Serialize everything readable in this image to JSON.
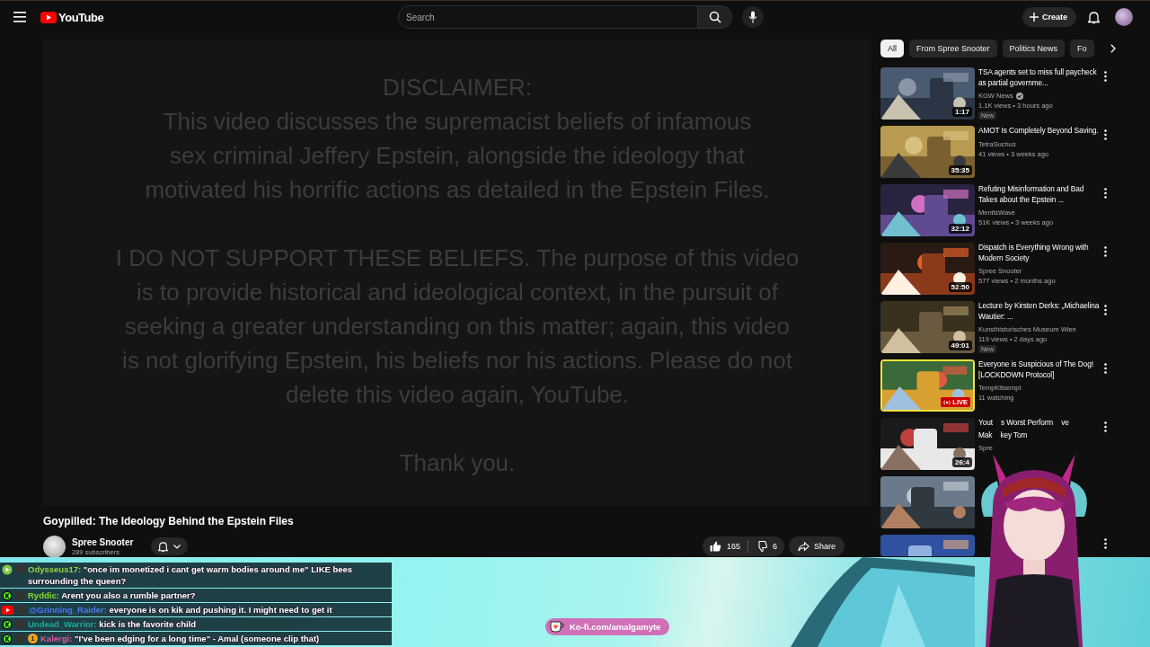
{
  "header": {
    "logo_text": "YouTube",
    "search": {
      "placeholder": "Search"
    },
    "create_label": "Create"
  },
  "video": {
    "disclaimer": [
      [
        "DISCLAIMER:",
        "This video discusses the supremacist beliefs of infamous",
        "sex criminal Jeffery Epstein, alongside the ideology that",
        "motivated his horrific actions as detailed in the Epstein Files."
      ],
      [
        "I DO NOT SUPPORT THESE BELIEFS. The purpose of this video",
        "is to provide historical and ideological context, in the pursuit of",
        "seeking a greater understanding on this matter; again, this video",
        "is not glorifying Epstein, his beliefs nor his actions. Please do not",
        "delete this video again, YouTube."
      ],
      [
        "Thank you."
      ]
    ],
    "title": "Goypilled: The Ideology Behind the Epstein Files",
    "channel": {
      "name": "Spree Snooter",
      "subscribers": "289 subscribers"
    },
    "likes": "165",
    "dislikes": "6",
    "share_label": "Share"
  },
  "chips": [
    {
      "label": "All",
      "selected": true
    },
    {
      "label": "From Spree Snooter",
      "selected": false
    },
    {
      "label": "Politics News",
      "selected": false
    },
    {
      "label": "Fo",
      "selected": false
    }
  ],
  "recommendations": [
    {
      "kind": "video",
      "title": "TSA agents set to miss full paycheck as partial governme...",
      "channel": "KGW News",
      "verified": true,
      "meta": "1.1K views • 3 hours ago",
      "badge": "New",
      "duration": "1:17",
      "menu": true
    },
    {
      "kind": "video",
      "title": "AMOT Is Completely Beyond Saving.",
      "channel": "TetraSuchus",
      "verified": false,
      "meta": "41 views • 3 weeks ago",
      "duration": "35:35",
      "menu": true
    },
    {
      "kind": "video",
      "title": "Refuting Misinformation and Bad Takes about the Epstein ...",
      "channel": "MentisWave",
      "verified": false,
      "meta": "51K views • 3 weeks ago",
      "duration": "32:12",
      "menu": true
    },
    {
      "kind": "video",
      "title": "Dispatch is Everything Wrong with Modern Society",
      "channel": "Spree Snooter",
      "verified": false,
      "meta": "577 views • 2 months ago",
      "duration": "52:50",
      "menu": true
    },
    {
      "kind": "video",
      "title": "Lecture by Kirsten Derks: „Michaelina Wautier: ...",
      "channel": "Kunsthistorisches Museum Wien",
      "verified": false,
      "meta": "119 views • 2 days ago",
      "badge": "New",
      "duration": "49:01",
      "menu": true
    },
    {
      "kind": "live",
      "title": "Everyone is Suspicious of The Dog! [LOCKDOWN Protocol]",
      "channel": "TempKitsempt",
      "verified": false,
      "meta": "11 watching",
      "live_label": "LIVE",
      "menu": true
    },
    {
      "kind": "covered",
      "title_lines": [
        [
          "Yout",
          "s Worst Perform",
          "ve"
        ],
        [
          "Mak",
          "key Tom"
        ]
      ],
      "channel": "Spre",
      "duration": "26:4",
      "menu": true
    },
    {
      "kind": "covered",
      "menu": false
    },
    {
      "kind": "covered",
      "menu": true
    }
  ],
  "chat": [
    {
      "kind": "rumble",
      "user": "Odysseus17:",
      "color": "#9ad23c",
      "message": "\"once im monetized i cant get warm bodies around me\" LIKE bees surrounding the queen?"
    },
    {
      "kind": "kick",
      "user": "Ryddic:",
      "color": "#84de2a",
      "message": "Arent you also a rumble partner?"
    },
    {
      "kind": "youtube",
      "user": "@Grinning_Raider:",
      "color": "#4a7af0",
      "message": "everyone is on kik and pushing it. I might need to get it"
    },
    {
      "kind": "kick",
      "user": "Undead_Warrior:",
      "color": "#1fae98",
      "message": "kick is the favorite child"
    },
    {
      "kind": "kick",
      "user": "Kalergi:",
      "color": "#e0579b",
      "badge": "1",
      "message": "\"I've been edging for a long time\" - Amal (someone clip that)"
    }
  ],
  "kofi": "Ko-fi.com/amalgamyte"
}
